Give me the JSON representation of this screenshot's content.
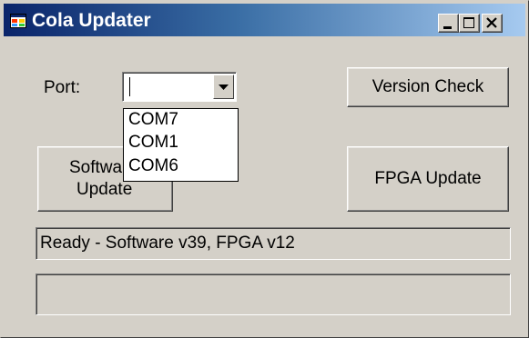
{
  "window": {
    "title": "Cola Updater"
  },
  "caption_buttons": [
    "minimize",
    "maximize",
    "close"
  ],
  "port": {
    "label": "Port:",
    "value": "",
    "options": [
      "COM7",
      "COM1",
      "COM6"
    ]
  },
  "buttons": {
    "version_check": "Version Check",
    "software_update_line1": "Softwa",
    "software_update_line2": "Update",
    "fpga_update": "FPGA Update"
  },
  "status": {
    "text": "Ready - Software v39, FPGA v12"
  },
  "progress": {
    "fraction": 0
  },
  "icons": [
    "app-icon",
    "minimize-icon",
    "maximize-icon",
    "close-icon",
    "dropdown-arrow-icon"
  ]
}
